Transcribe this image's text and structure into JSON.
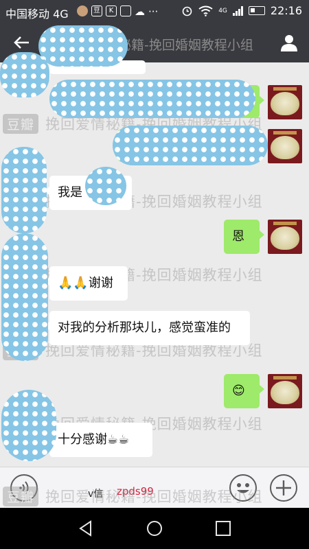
{
  "status_bar": {
    "carrier": "中国移动 4G",
    "time": "22:16",
    "network_label": "4G",
    "notification_icons": [
      "豆",
      "K"
    ]
  },
  "title_bar": {
    "title": "挽回爱情秘籍-挽回婚姻教程小组"
  },
  "watermark": {
    "brand": "豆瓣",
    "text": "挽回爱情秘籍-挽回婚姻教程小组"
  },
  "messages": [
    {
      "side": "left",
      "text": "我是"
    },
    {
      "side": "right",
      "text": "恩"
    },
    {
      "side": "left",
      "text": "🙏🙏谢谢"
    },
    {
      "side": "left",
      "text": "对我的分析那块儿，感觉蛮准的"
    },
    {
      "side": "right",
      "text": "😊"
    },
    {
      "side": "left",
      "text": "十分感谢☕☕"
    }
  ],
  "input_bar": {
    "vx_label": "v信",
    "vx_id": "zpds99"
  },
  "colors": {
    "header_bg": "#393a3f",
    "chat_bg": "#ebebeb",
    "sent_bubble": "#9eea6a",
    "received_bubble": "#ffffff",
    "censor_blob": "#86c5e5",
    "vx_id_color": "#d4213d"
  },
  "icons": [
    "back-arrow-icon",
    "profile-icon",
    "voice-icon",
    "emoji-icon",
    "plus-icon",
    "nav-back-icon",
    "nav-home-icon",
    "nav-recents-icon",
    "wifi-icon",
    "alarm-icon",
    "battery-icon"
  ]
}
